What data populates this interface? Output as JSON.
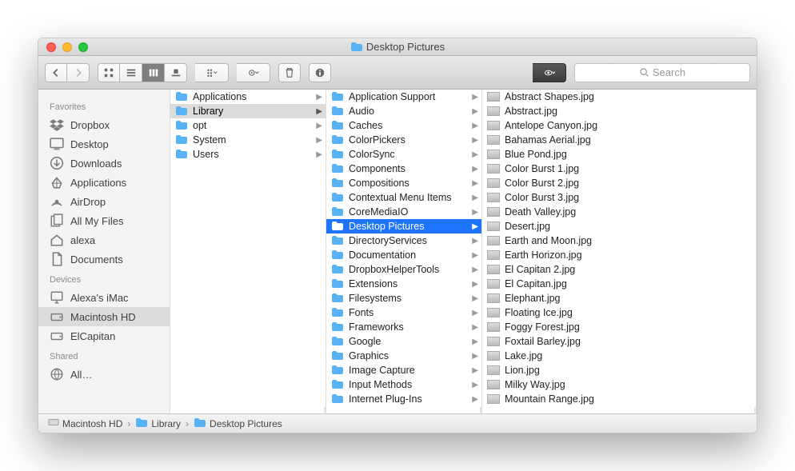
{
  "window_title": "Desktop Pictures",
  "search_placeholder": "Search",
  "sidebar": {
    "sections": [
      {
        "header": "Favorites",
        "items": [
          {
            "label": "Dropbox",
            "icon": "dropbox"
          },
          {
            "label": "Desktop",
            "icon": "desktop"
          },
          {
            "label": "Downloads",
            "icon": "downloads"
          },
          {
            "label": "Applications",
            "icon": "applications"
          },
          {
            "label": "AirDrop",
            "icon": "airdrop"
          },
          {
            "label": "All My Files",
            "icon": "allfiles"
          },
          {
            "label": "alexa",
            "icon": "home"
          },
          {
            "label": "Documents",
            "icon": "documents"
          }
        ]
      },
      {
        "header": "Devices",
        "items": [
          {
            "label": "Alexa's iMac",
            "icon": "imac"
          },
          {
            "label": "Macintosh HD",
            "icon": "hdd",
            "selected": true
          },
          {
            "label": "ElCapitan",
            "icon": "hdd"
          }
        ]
      },
      {
        "header": "Shared",
        "items": [
          {
            "label": "All…",
            "icon": "globe"
          }
        ]
      }
    ]
  },
  "columns": [
    {
      "items": [
        {
          "label": "Applications",
          "type": "folder",
          "nav": true
        },
        {
          "label": "Library",
          "type": "folder",
          "nav": true,
          "selected": "gray"
        },
        {
          "label": "opt",
          "type": "folder",
          "nav": true
        },
        {
          "label": "System",
          "type": "folder",
          "nav": true
        },
        {
          "label": "Users",
          "type": "folder",
          "nav": true
        }
      ]
    },
    {
      "items": [
        {
          "label": "Application Support",
          "type": "folder",
          "nav": true
        },
        {
          "label": "Audio",
          "type": "folder",
          "nav": true
        },
        {
          "label": "Caches",
          "type": "folder",
          "nav": true
        },
        {
          "label": "ColorPickers",
          "type": "folder",
          "nav": true
        },
        {
          "label": "ColorSync",
          "type": "folder",
          "nav": true
        },
        {
          "label": "Components",
          "type": "folder",
          "nav": true
        },
        {
          "label": "Compositions",
          "type": "folder",
          "nav": true
        },
        {
          "label": "Contextual Menu Items",
          "type": "folder",
          "nav": true
        },
        {
          "label": "CoreMediaIO",
          "type": "folder",
          "nav": true
        },
        {
          "label": "Desktop Pictures",
          "type": "folder",
          "nav": true,
          "selected": "blue"
        },
        {
          "label": "DirectoryServices",
          "type": "folder",
          "nav": true
        },
        {
          "label": "Documentation",
          "type": "folder",
          "nav": true
        },
        {
          "label": "DropboxHelperTools",
          "type": "folder",
          "nav": true
        },
        {
          "label": "Extensions",
          "type": "folder",
          "nav": true
        },
        {
          "label": "Filesystems",
          "type": "folder",
          "nav": true
        },
        {
          "label": "Fonts",
          "type": "folder",
          "nav": true
        },
        {
          "label": "Frameworks",
          "type": "folder",
          "nav": true
        },
        {
          "label": "Google",
          "type": "folder",
          "nav": true
        },
        {
          "label": "Graphics",
          "type": "folder",
          "nav": true
        },
        {
          "label": "Image Capture",
          "type": "folder",
          "nav": true
        },
        {
          "label": "Input Methods",
          "type": "folder",
          "nav": true
        },
        {
          "label": "Internet Plug-Ins",
          "type": "folder",
          "nav": true
        }
      ]
    },
    {
      "items": [
        {
          "label": "Abstract Shapes.jpg",
          "type": "file"
        },
        {
          "label": "Abstract.jpg",
          "type": "file"
        },
        {
          "label": "Antelope Canyon.jpg",
          "type": "file"
        },
        {
          "label": "Bahamas Aerial.jpg",
          "type": "file"
        },
        {
          "label": "Blue Pond.jpg",
          "type": "file"
        },
        {
          "label": "Color Burst 1.jpg",
          "type": "file"
        },
        {
          "label": "Color Burst 2.jpg",
          "type": "file"
        },
        {
          "label": "Color Burst 3.jpg",
          "type": "file"
        },
        {
          "label": "Death Valley.jpg",
          "type": "file"
        },
        {
          "label": "Desert.jpg",
          "type": "file"
        },
        {
          "label": "Earth and Moon.jpg",
          "type": "file"
        },
        {
          "label": "Earth Horizon.jpg",
          "type": "file"
        },
        {
          "label": "El Capitan 2.jpg",
          "type": "file"
        },
        {
          "label": "El Capitan.jpg",
          "type": "file"
        },
        {
          "label": "Elephant.jpg",
          "type": "file"
        },
        {
          "label": "Floating Ice.jpg",
          "type": "file"
        },
        {
          "label": "Foggy Forest.jpg",
          "type": "file"
        },
        {
          "label": "Foxtail Barley.jpg",
          "type": "file"
        },
        {
          "label": "Lake.jpg",
          "type": "file"
        },
        {
          "label": "Lion.jpg",
          "type": "file"
        },
        {
          "label": "Milky Way.jpg",
          "type": "file"
        },
        {
          "label": "Mountain Range.jpg",
          "type": "file"
        }
      ]
    }
  ],
  "breadcrumbs": [
    {
      "label": "Macintosh HD",
      "icon": "hdd"
    },
    {
      "label": "Library",
      "icon": "folder"
    },
    {
      "label": "Desktop Pictures",
      "icon": "folder"
    }
  ]
}
